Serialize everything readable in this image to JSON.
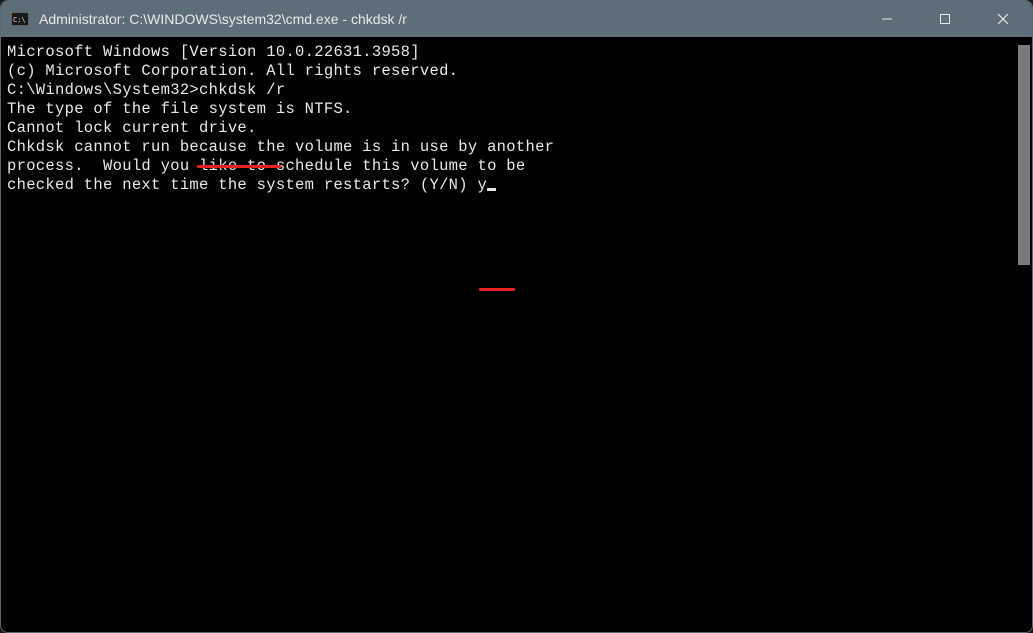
{
  "window": {
    "title": "Administrator: C:\\WINDOWS\\system32\\cmd.exe - chkdsk  /r"
  },
  "terminal": {
    "line1": "Microsoft Windows [Version 10.0.22631.3958]",
    "line2": "(c) Microsoft Corporation. All rights reserved.",
    "blank1": "",
    "prompt_path": "C:\\Windows\\System32>",
    "prompt_cmd": "chkdsk /r",
    "line4": "The type of the file system is NTFS.",
    "line5": "Cannot lock current drive.",
    "blank2": "",
    "line6": "Chkdsk cannot run because the volume is in use by another",
    "line7": "process.  Would you like to schedule this volume to be",
    "line8_prefix": "checked the next time the system restarts? (Y/N) ",
    "line8_input": "y"
  }
}
